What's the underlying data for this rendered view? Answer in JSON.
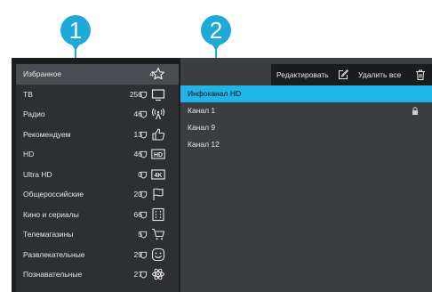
{
  "callouts": [
    {
      "label": "1",
      "color": "#1fa9d8"
    },
    {
      "label": "2",
      "color": "#1fa9d8"
    }
  ],
  "categories": [
    {
      "name": "Избранное",
      "count": "4",
      "icon": "star-icon",
      "selected": true
    },
    {
      "name": "ТВ",
      "count": "256",
      "icon": "tv-icon"
    },
    {
      "name": "Радио",
      "count": "46",
      "icon": "radio-icon"
    },
    {
      "name": "Рекомендуем",
      "count": "13",
      "icon": "thumbs-up-icon"
    },
    {
      "name": "HD",
      "count": "46",
      "icon": "hd-icon",
      "badge": "HD"
    },
    {
      "name": "Ultra HD",
      "count": "0",
      "icon": "4k-icon",
      "badge": "4K"
    },
    {
      "name": "Общероссийские",
      "count": "20",
      "icon": "flag-icon"
    },
    {
      "name": "Кино и сериалы",
      "count": "66",
      "icon": "film-icon"
    },
    {
      "name": "Телемагазины",
      "count": "5",
      "icon": "cart-icon"
    },
    {
      "name": "Развлекательные",
      "count": "29",
      "icon": "smiley-icon"
    },
    {
      "name": "Познавательные",
      "count": "27",
      "icon": "atom-icon"
    }
  ],
  "toolbar": {
    "edit_label": "Редактировать",
    "edit_icon": "edit-icon",
    "delete_label": "Удалить все",
    "delete_icon": "trash-icon"
  },
  "channels": [
    {
      "name": "Инфоканал HD",
      "selected": true
    },
    {
      "name": "Канал 1",
      "locked": true
    },
    {
      "name": "Канал 9"
    },
    {
      "name": "Канал 12"
    }
  ],
  "colors": {
    "accent": "#1fa9d8",
    "selection": "#21b4e6"
  }
}
